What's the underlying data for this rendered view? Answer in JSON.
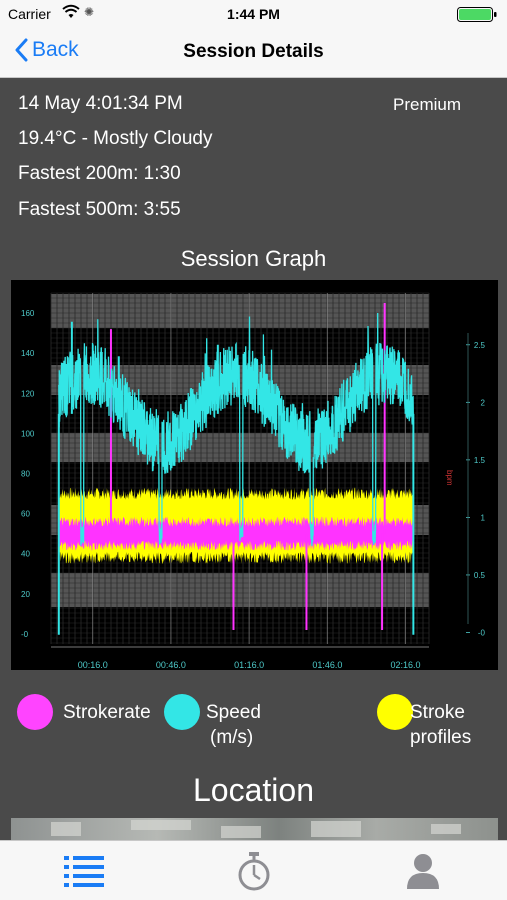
{
  "status_bar": {
    "carrier": "Carrier",
    "time": "1:44 PM"
  },
  "nav": {
    "back_label": "Back",
    "title": "Session Details"
  },
  "session": {
    "datetime": "14 May 4:01:34 PM",
    "weather": "19.4°C - Mostly Cloudy",
    "fastest_200": "Fastest 200m: 1:30",
    "fastest_500": "Fastest 500m: 3:55",
    "badge": "Premium"
  },
  "graph_title": "Session Graph",
  "chart_data": {
    "type": "line",
    "title": "",
    "x": [
      "00:16.0",
      "00:46.0",
      "01:16.0",
      "01:46.0",
      "02:16.0"
    ],
    "xlim": [
      0,
      145
    ],
    "left_axis": {
      "ticks": [
        "-0",
        "20",
        "40",
        "60",
        "80",
        "100",
        "120",
        "140",
        "160"
      ],
      "ylim": [
        -5,
        170
      ]
    },
    "right_axis": {
      "label": "bpm",
      "ticks": [
        "-0",
        "0.5",
        "1",
        "1.5",
        "2",
        "2.5"
      ],
      "ylim": [
        -0.1,
        2.95
      ]
    },
    "series": [
      {
        "name": "Strokerate",
        "color": "#ff33ff",
        "approx_range": [
          42,
          58
        ],
        "axis": "left"
      },
      {
        "name": "Speed",
        "color": "#33e6e6",
        "approx_range": [
          1.6,
          2.4
        ],
        "axis": "right"
      },
      {
        "name": "Stroke profiles",
        "color": "#ffff00",
        "approx_range": [
          38,
          70
        ],
        "axis": "left"
      }
    ],
    "grid": true
  },
  "legend": [
    {
      "label_lines": [
        "Strokerate"
      ],
      "color": "#ff44ff"
    },
    {
      "label_lines": [
        "Speed",
        "(m/s)"
      ],
      "color": "#33e6e6"
    },
    {
      "label_lines": [
        "Stroke",
        "profiles"
      ],
      "color": "#ffff00"
    }
  ],
  "location_title": "Location",
  "tabbar": {
    "items": [
      {
        "icon": "list-icon",
        "active": true
      },
      {
        "icon": "stopwatch-icon",
        "active": false
      },
      {
        "icon": "profile-icon",
        "active": false
      }
    ]
  }
}
